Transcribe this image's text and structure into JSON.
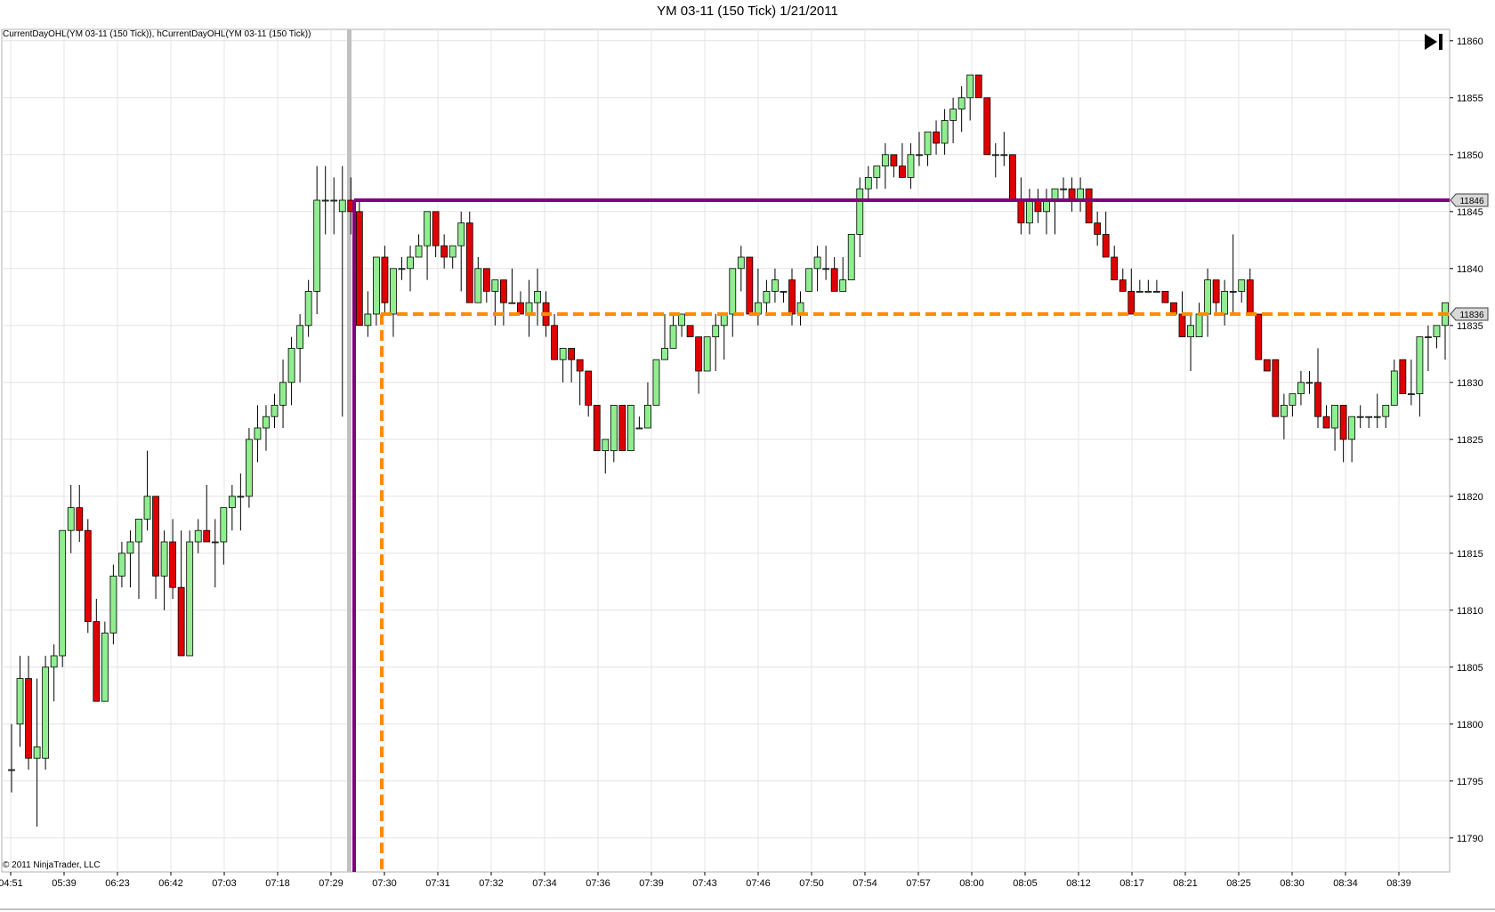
{
  "window": {
    "title": "YM 03-11 (150 Tick)  1/21/2011",
    "indicator_label": "CurrentDayOHL(YM 03-11 (150 Tick)), hCurrentDayOHL(YM 03-11 (150 Tick))",
    "copyright": "© 2011 NinjaTrader, LLC",
    "go_last_icon": "skip-to-end-icon"
  },
  "colors": {
    "up_candle": "#90EE90",
    "down_candle": "#E00000",
    "current_day_high": "#800080",
    "current_day_low": "#FF8C00",
    "session_break": "#C0C0C0",
    "grid": "#E4E4E4"
  },
  "chart_data": {
    "type": "candlestick",
    "title": "YM 03-11 (150 Tick)  1/21/2011",
    "ylim": [
      11786,
      11861
    ],
    "y_ticks": [
      11790,
      11795,
      11800,
      11805,
      11810,
      11815,
      11820,
      11825,
      11830,
      11835,
      11840,
      11845,
      11850,
      11855,
      11860
    ],
    "x_tick_labels": [
      "04:51",
      "05:39",
      "06:23",
      "06:42",
      "07:03",
      "07:18",
      "07:29",
      "07:30",
      "07:31",
      "07:32",
      "07:34",
      "07:36",
      "07:39",
      "07:43",
      "07:46",
      "07:50",
      "07:54",
      "07:57",
      "08:00",
      "08:05",
      "08:12",
      "08:17",
      "08:21",
      "08:25",
      "08:30",
      "08:34",
      "08:39"
    ],
    "grid": true,
    "candles": [
      [
        11796,
        11800,
        11794,
        11796
      ],
      [
        11800,
        11806,
        11798,
        11804
      ],
      [
        11804,
        11806,
        11796,
        11797
      ],
      [
        11797,
        11804,
        11791,
        11798
      ],
      [
        11797,
        11806,
        11796,
        11805
      ],
      [
        11805,
        11807,
        11802,
        11806
      ],
      [
        11806,
        11817,
        11805,
        11817
      ],
      [
        11817,
        11821,
        11815,
        11819
      ],
      [
        11819,
        11821,
        11816,
        11817
      ],
      [
        11817,
        11818,
        11808,
        11809
      ],
      [
        11809,
        11811,
        11802,
        11802
      ],
      [
        11802,
        11809,
        11804,
        11808
      ],
      [
        11808,
        11814,
        11807,
        11813
      ],
      [
        11813,
        11816,
        11812,
        11815
      ],
      [
        11815,
        11817,
        11812,
        11816
      ],
      [
        11816,
        11817,
        11811,
        11818
      ],
      [
        11818,
        11824,
        11817,
        11820
      ],
      [
        11820,
        11820,
        11811,
        11813
      ],
      [
        11813,
        11817,
        11810,
        11816
      ],
      [
        11816,
        11818,
        11811,
        11812
      ],
      [
        11812,
        11817,
        11806,
        11806
      ],
      [
        11806,
        11817,
        11806,
        11816
      ],
      [
        11816,
        11818,
        11815,
        11817
      ],
      [
        11817,
        11821,
        11816,
        11816
      ],
      [
        11816,
        11818,
        11812,
        11816
      ],
      [
        11816,
        11819,
        11814,
        11819
      ],
      [
        11819,
        11821,
        11817,
        11820
      ],
      [
        11820,
        11822,
        11817,
        11820
      ],
      [
        11820,
        11826,
        11819,
        11825
      ],
      [
        11825,
        11828,
        11823,
        11826
      ],
      [
        11826,
        11828,
        11824,
        11827
      ],
      [
        11827,
        11829,
        11826,
        11828
      ],
      [
        11828,
        11832,
        11826,
        11830
      ],
      [
        11830,
        11834,
        11828,
        11833
      ],
      [
        11833,
        11836,
        11830,
        11835
      ],
      [
        11835,
        11839,
        11834,
        11838
      ],
      [
        11838,
        11849,
        11836,
        11846
      ],
      [
        11846,
        11849,
        11843,
        11846
      ],
      [
        11846,
        11848,
        11843,
        11846
      ],
      [
        11845,
        11849,
        11827,
        11846
      ],
      [
        11846,
        11848,
        11843,
        11845
      ],
      [
        11845,
        11846,
        11835,
        11835
      ],
      [
        11835,
        11838,
        11834,
        11836
      ],
      [
        11836,
        11841,
        11835,
        11841
      ],
      [
        11841,
        11842,
        11836,
        11837
      ],
      [
        11836,
        11840,
        11834,
        11840
      ],
      [
        11840,
        11841,
        11839,
        11840
      ],
      [
        11840,
        11842,
        11838,
        11841
      ],
      [
        11841,
        11843,
        11841,
        11842
      ],
      [
        11842,
        11845,
        11839,
        11845
      ],
      [
        11845,
        11845,
        11841,
        11842
      ],
      [
        11842,
        11843,
        11840,
        11841
      ],
      [
        11841,
        11842,
        11840,
        11842
      ],
      [
        11842,
        11845,
        11838,
        11844
      ],
      [
        11844,
        11845,
        11837,
        11837
      ],
      [
        11837,
        11841,
        11837,
        11840
      ],
      [
        11840,
        11840,
        11837,
        11838
      ],
      [
        11838,
        11839,
        11835,
        11839
      ],
      [
        11839,
        11839,
        11835,
        11837
      ],
      [
        11837,
        11840,
        11837,
        11837
      ],
      [
        11837,
        11838,
        11836,
        11836
      ],
      [
        11836,
        11839,
        11834,
        11837
      ],
      [
        11837,
        11840,
        11835,
        11838
      ],
      [
        11837,
        11838,
        11834,
        11835
      ],
      [
        11835,
        11836,
        11832,
        11832
      ],
      [
        11832,
        11833,
        11830,
        11833
      ],
      [
        11833,
        11833,
        11830,
        11832
      ],
      [
        11832,
        11832,
        11828,
        11831
      ],
      [
        11831,
        11831,
        11827,
        11828
      ],
      [
        11828,
        11828,
        11824,
        11824
      ],
      [
        11824,
        11825,
        11822,
        11825
      ],
      [
        11824,
        11828,
        11823,
        11828
      ],
      [
        11828,
        11828,
        11824,
        11824
      ],
      [
        11824,
        11828,
        11824,
        11828
      ],
      [
        11826,
        11827,
        11826,
        11826
      ],
      [
        11826,
        11830,
        11826,
        11828
      ],
      [
        11828,
        11831,
        11828,
        11832
      ],
      [
        11832,
        11836,
        11832,
        11833
      ],
      [
        11833,
        11836,
        11833,
        11835
      ],
      [
        11835,
        11836,
        11834,
        11836
      ],
      [
        11835,
        11834,
        11834,
        11834
      ],
      [
        11834,
        11834,
        11829,
        11831
      ],
      [
        11831,
        11834,
        11831,
        11834
      ],
      [
        11834,
        11836,
        11831,
        11835
      ],
      [
        11835,
        11836,
        11832,
        11836
      ],
      [
        11836,
        11840,
        11834,
        11840
      ],
      [
        11840,
        11842,
        11838,
        11841
      ],
      [
        11841,
        11841,
        11836,
        11836
      ],
      [
        11836,
        11840,
        11835,
        11837
      ],
      [
        11837,
        11839,
        11836,
        11838
      ],
      [
        11838,
        11840,
        11837,
        11839
      ],
      [
        11838,
        11838,
        11837,
        11838
      ],
      [
        11839,
        11840,
        11835,
        11836
      ],
      [
        11836,
        11838,
        11835,
        11837
      ],
      [
        11838,
        11840,
        11838,
        11840
      ],
      [
        11840,
        11842,
        11838,
        11841
      ],
      [
        11840,
        11842,
        11839,
        11840
      ],
      [
        11840,
        11841,
        11838,
        11838
      ],
      [
        11838,
        11841,
        11838,
        11839
      ],
      [
        11839,
        11843,
        11839,
        11843
      ],
      [
        11843,
        11848,
        11841,
        11847
      ],
      [
        11847,
        11849,
        11846,
        11848
      ],
      [
        11848,
        11849,
        11847,
        11849
      ],
      [
        11849,
        11851,
        11847,
        11850
      ],
      [
        11850,
        11850,
        11848,
        11849
      ],
      [
        11849,
        11851,
        11848,
        11848
      ],
      [
        11848,
        11851,
        11847,
        11850
      ],
      [
        11850,
        11852,
        11849,
        11850
      ],
      [
        11850,
        11851,
        11849,
        11852
      ],
      [
        11852,
        11853,
        11850,
        11851
      ],
      [
        11851,
        11854,
        11850,
        11853
      ],
      [
        11853,
        11855,
        11851,
        11854
      ],
      [
        11854,
        11856,
        11852,
        11855
      ],
      [
        11855,
        11857,
        11853,
        11857
      ],
      [
        11857,
        11857,
        11855,
        11855
      ],
      [
        11855,
        11855,
        11850,
        11850
      ],
      [
        11850,
        11851,
        11848,
        11850
      ],
      [
        11850,
        11852,
        11849,
        11850
      ],
      [
        11850,
        11850,
        11846,
        11846
      ],
      [
        11846,
        11848,
        11843,
        11844
      ],
      [
        11844,
        11847,
        11843,
        11846
      ],
      [
        11846,
        11847,
        11844,
        11845
      ],
      [
        11845,
        11847,
        11843,
        11846
      ],
      [
        11846,
        11847,
        11843,
        11847
      ],
      [
        11847,
        11848,
        11846,
        11847
      ],
      [
        11847,
        11848,
        11845,
        11846
      ],
      [
        11846,
        11848,
        11845,
        11847
      ],
      [
        11847,
        11847,
        11844,
        11844
      ],
      [
        11844,
        11845,
        11842,
        11843
      ],
      [
        11843,
        11845,
        11841,
        11841
      ],
      [
        11841,
        11842,
        11839,
        11839
      ],
      [
        11839,
        11840,
        11838,
        11838
      ],
      [
        11838,
        11840,
        11836,
        11836
      ],
      [
        11838,
        11839,
        11838,
        11838
      ],
      [
        11838,
        11839,
        11838,
        11838
      ],
      [
        11838,
        11839,
        11838,
        11838
      ],
      [
        11838,
        11838,
        11837,
        11837
      ],
      [
        11837,
        11837,
        11836,
        11836
      ],
      [
        11836,
        11838,
        11834,
        11834
      ],
      [
        11834,
        11836,
        11831,
        11835
      ],
      [
        11834,
        11837,
        11834,
        11836
      ],
      [
        11836,
        11840,
        11834,
        11839
      ],
      [
        11839,
        11839,
        11836,
        11837
      ],
      [
        11836,
        11839,
        11835,
        11838
      ],
      [
        11838,
        11843,
        11836,
        11838
      ],
      [
        11838,
        11839,
        11837,
        11839
      ],
      [
        11839,
        11840,
        11836,
        11836
      ],
      [
        11836,
        11836,
        11832,
        11832
      ],
      [
        11832,
        11832,
        11831,
        11831
      ],
      [
        11832,
        11832,
        11827,
        11827
      ],
      [
        11827,
        11829,
        11825,
        11828
      ],
      [
        11828,
        11829,
        11827,
        11829
      ],
      [
        11829,
        11831,
        11828,
        11830
      ],
      [
        11830,
        11831,
        11829,
        11830
      ],
      [
        11830,
        11833,
        11826,
        11827
      ],
      [
        11827,
        11828,
        11826,
        11826
      ],
      [
        11826,
        11828,
        11824,
        11828
      ],
      [
        11828,
        11828,
        11823,
        11825
      ],
      [
        11825,
        11827,
        11823,
        11827
      ],
      [
        11827,
        11828,
        11826,
        11827
      ],
      [
        11827,
        11827,
        11826,
        11827
      ],
      [
        11827,
        11829,
        11826,
        11827
      ],
      [
        11827,
        11828,
        11826,
        11828
      ],
      [
        11828,
        11832,
        11828,
        11831
      ],
      [
        11832,
        11832,
        11829,
        11829
      ],
      [
        11829,
        11832,
        11828,
        11829
      ],
      [
        11829,
        11834,
        11827,
        11834
      ],
      [
        11834,
        11835,
        11831,
        11834
      ],
      [
        11834,
        11835,
        11833,
        11835
      ],
      [
        11835,
        11837,
        11832,
        11837
      ]
    ],
    "levels": {
      "current_day_high": 11846,
      "current_day_low": 11836,
      "high_marker_label": "11846",
      "low_marker_label": "11836"
    }
  }
}
